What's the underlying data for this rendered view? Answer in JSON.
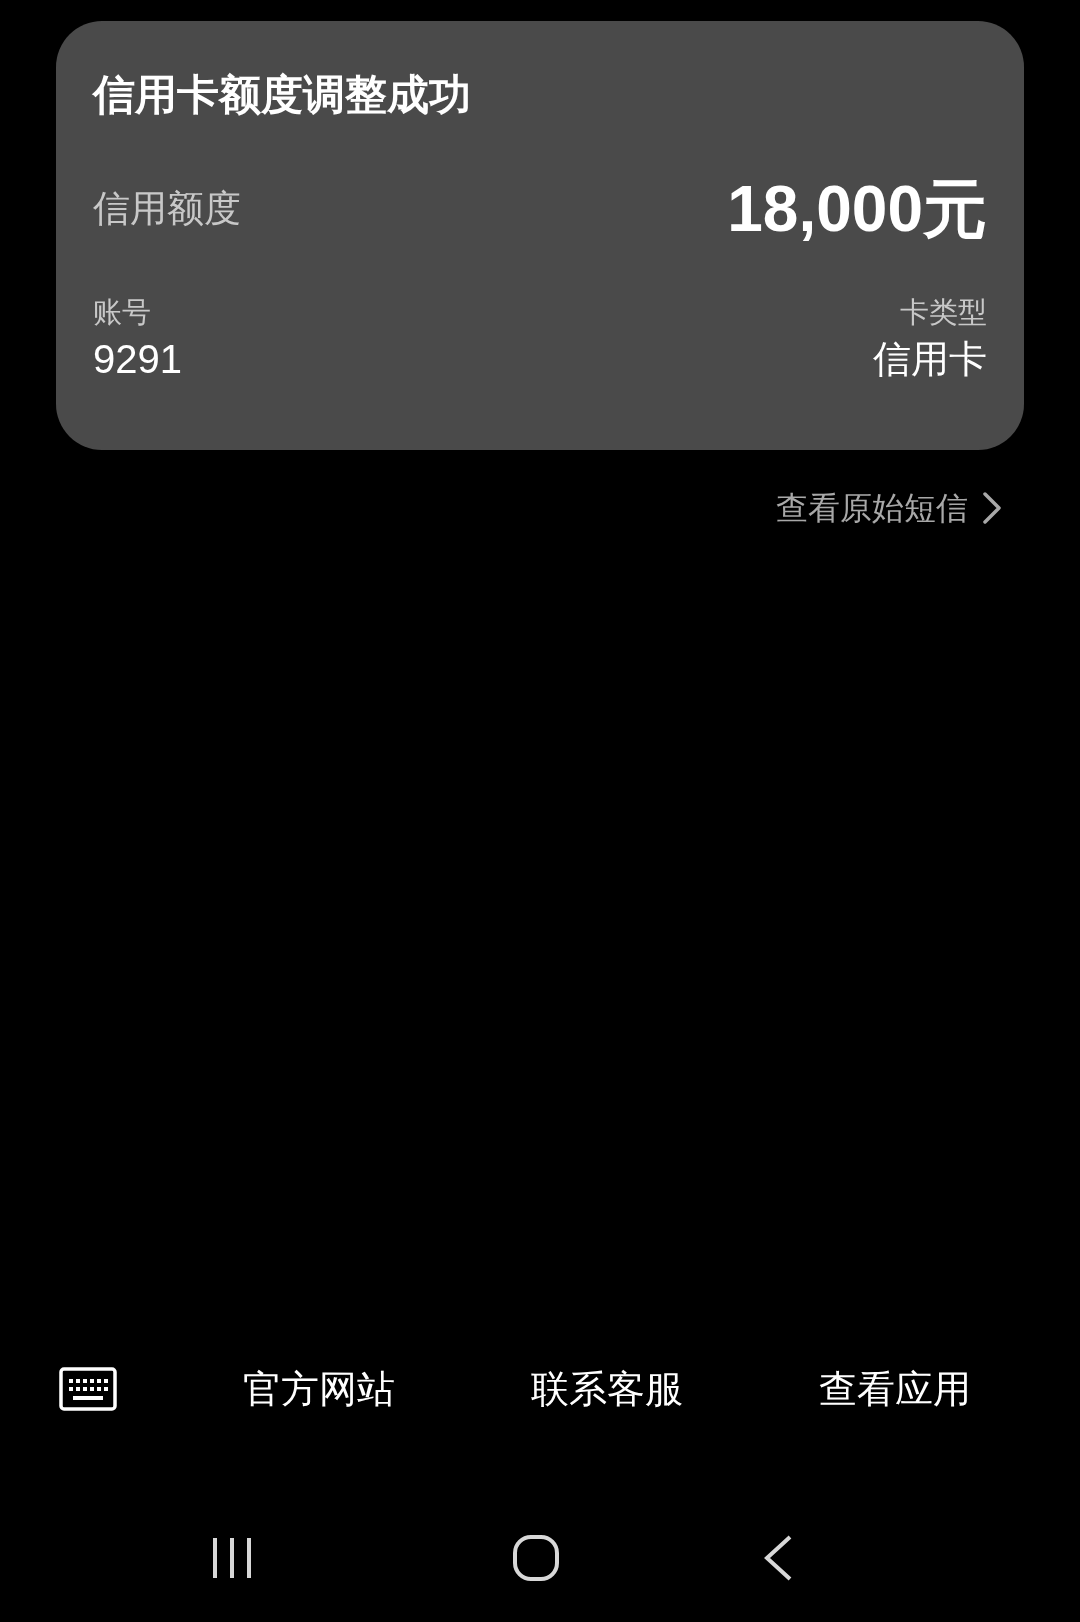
{
  "card": {
    "title": "信用卡额度调整成功",
    "limit_label": "信用额度",
    "limit_value": "18,000元",
    "account_label": "账号",
    "account_value": "9291",
    "type_label": "卡类型",
    "type_value": "信用卡"
  },
  "link": "查看原始短信",
  "actions": [
    "官方网站",
    "联系客服",
    "查看应用"
  ]
}
